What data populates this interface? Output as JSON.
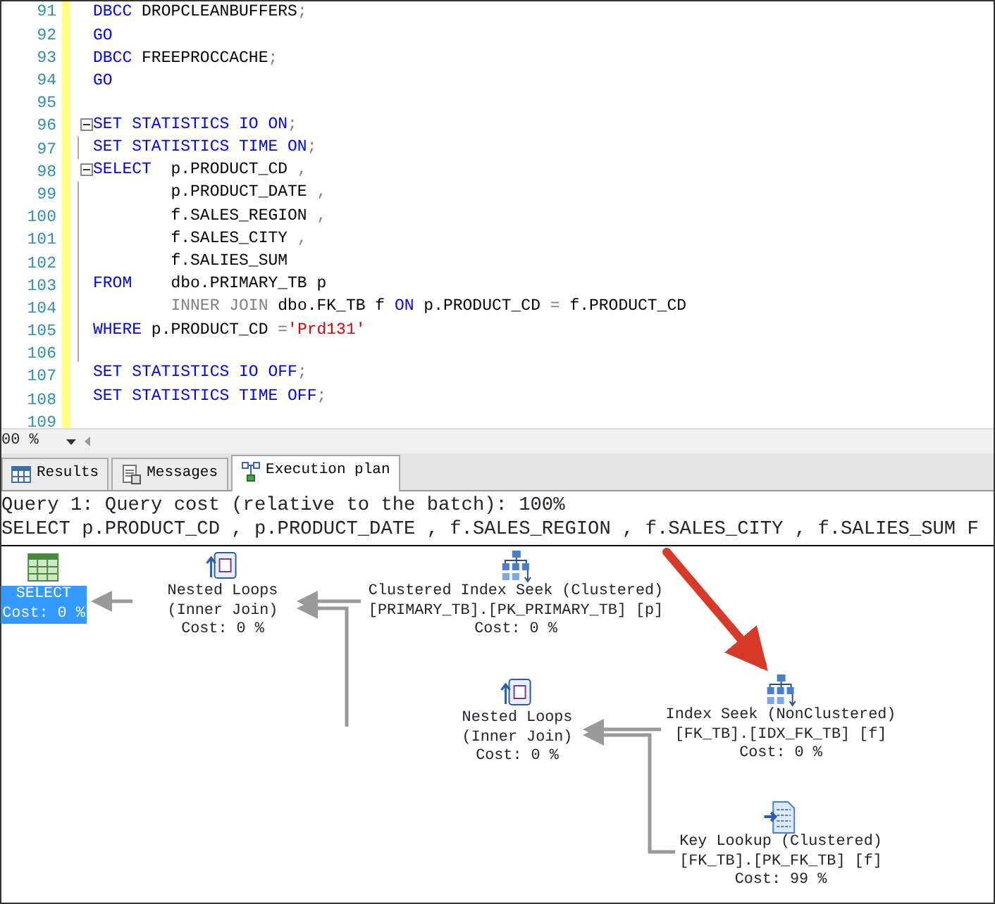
{
  "editor": {
    "lines": [
      {
        "number": "91",
        "collapsible": false,
        "tokens": [
          {
            "kind": "keyword",
            "text": "DBCC"
          },
          {
            "kind": "plain",
            "text": " DROPCLEANBUFFERS"
          },
          {
            "kind": "punct",
            "text": ";"
          }
        ]
      },
      {
        "number": "92",
        "collapsible": false,
        "tokens": [
          {
            "kind": "keyword",
            "text": "GO"
          }
        ]
      },
      {
        "number": "93",
        "collapsible": false,
        "tokens": [
          {
            "kind": "keyword",
            "text": "DBCC"
          },
          {
            "kind": "plain",
            "text": " FREEPROCCACHE"
          },
          {
            "kind": "punct",
            "text": ";"
          }
        ]
      },
      {
        "number": "94",
        "collapsible": false,
        "tokens": [
          {
            "kind": "keyword",
            "text": "GO"
          }
        ]
      },
      {
        "number": "95",
        "collapsible": false
      },
      {
        "number": "96",
        "collapsible": true,
        "tokens": [
          {
            "kind": "keyword",
            "text": "SET STATISTICS IO ON"
          },
          {
            "kind": "punct",
            "text": ";"
          }
        ]
      },
      {
        "number": "97",
        "collapsible": false,
        "tokens": [
          {
            "kind": "keyword",
            "text": "SET STATISTICS TIME ON"
          },
          {
            "kind": "punct",
            "text": ";"
          }
        ]
      },
      {
        "number": "98",
        "collapsible": true,
        "tokens": [
          {
            "kind": "keyword",
            "text": "SELECT"
          },
          {
            "kind": "plain",
            "text": "  p.PRODUCT_CD "
          },
          {
            "kind": "punct",
            "text": ","
          }
        ]
      },
      {
        "number": "99",
        "collapsible": false,
        "tokens": [
          {
            "kind": "plain",
            "text": "        p.PRODUCT_DATE "
          },
          {
            "kind": "punct",
            "text": ","
          }
        ]
      },
      {
        "number": "100",
        "collapsible": false,
        "tokens": [
          {
            "kind": "plain",
            "text": "        f.SALES_REGION "
          },
          {
            "kind": "punct",
            "text": ","
          }
        ]
      },
      {
        "number": "101",
        "collapsible": false,
        "tokens": [
          {
            "kind": "plain",
            "text": "        f.SALES_CITY "
          },
          {
            "kind": "punct",
            "text": ","
          }
        ]
      },
      {
        "number": "102",
        "collapsible": false,
        "tokens": [
          {
            "kind": "plain",
            "text": "        f.SALIES_SUM"
          }
        ]
      },
      {
        "number": "103",
        "collapsible": false,
        "tokens": [
          {
            "kind": "keyword",
            "text": "FROM"
          },
          {
            "kind": "plain",
            "text": "    dbo.PRIMARY_TB p"
          }
        ]
      },
      {
        "number": "104",
        "collapsible": false,
        "tokens": [
          {
            "kind": "punct",
            "text": "        INNER JOIN"
          },
          {
            "kind": "plain",
            "text": " dbo.FK_TB f "
          },
          {
            "kind": "keyword",
            "text": "ON"
          },
          {
            "kind": "plain",
            "text": " p.PRODUCT_CD "
          },
          {
            "kind": "punct",
            "text": "="
          },
          {
            "kind": "plain",
            "text": " f.PRODUCT_CD"
          }
        ]
      },
      {
        "number": "105",
        "collapsible": false,
        "tokens": [
          {
            "kind": "keyword",
            "text": "WHERE"
          },
          {
            "kind": "plain",
            "text": " p.PRODUCT_CD "
          },
          {
            "kind": "punct",
            "text": "="
          },
          {
            "kind": "string",
            "text": "'Prd131'"
          }
        ]
      },
      {
        "number": "106",
        "collapsible": false
      },
      {
        "number": "107",
        "collapsible": false,
        "tokens": [
          {
            "kind": "keyword",
            "text": "SET STATISTICS IO OFF"
          },
          {
            "kind": "punct",
            "text": ";"
          }
        ]
      },
      {
        "number": "108",
        "collapsible": false,
        "tokens": [
          {
            "kind": "keyword",
            "text": "SET STATISTICS TIME OFF"
          },
          {
            "kind": "punct",
            "text": ";"
          }
        ]
      },
      {
        "number": "109",
        "collapsible": false
      }
    ]
  },
  "zoom": {
    "value": "00 %"
  },
  "tabs": [
    {
      "label": "Results",
      "kind": "grid",
      "selected": false
    },
    {
      "label": "Messages",
      "kind": "messages",
      "selected": false
    },
    {
      "label": "Execution plan",
      "kind": "plan",
      "selected": true
    }
  ],
  "plan": {
    "header": "Query 1: Query cost (relative to the batch): 100%",
    "statement": "SELECT p.PRODUCT_CD , p.PRODUCT_DATE , f.SALES_REGION , f.SALES_CITY , f.SALIES_SUM F",
    "operators": [
      {
        "kind": "select",
        "selected": true,
        "lines": [
          "SELECT",
          "Cost: 0 %"
        ]
      },
      {
        "kind": "nested_loops",
        "selected": false,
        "lines": [
          "Nested Loops",
          "(Inner Join)",
          "Cost: 0 %"
        ]
      },
      {
        "kind": "index_seek",
        "selected": false,
        "lines": [
          "Clustered Index Seek (Clustered)",
          "[PRIMARY_TB].[PK_PRIMARY_TB] [p]",
          "Cost: 0 %"
        ]
      },
      {
        "kind": "nested_loops",
        "selected": false,
        "lines": [
          "Nested Loops",
          "(Inner Join)",
          "Cost: 0 %"
        ]
      },
      {
        "kind": "index_seek",
        "selected": false,
        "lines": [
          "Index Seek (NonClustered)",
          "[FK_TB].[IDX_FK_TB] [f]",
          "Cost: 0 %"
        ]
      },
      {
        "kind": "key_lookup",
        "selected": false,
        "lines": [
          "Key Lookup (Clustered)",
          "[FK_TB].[PK_FK_TB] [f]",
          "Cost: 99 %"
        ]
      }
    ]
  }
}
